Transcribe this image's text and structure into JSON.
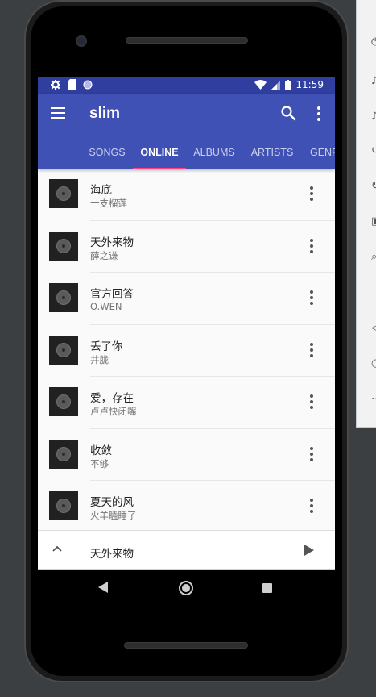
{
  "status_bar": {
    "time": "11:59",
    "icons_left": [
      "settings-icon",
      "sd-card-icon",
      "sync-circle-icon"
    ],
    "icons_right": [
      "wifi-icon",
      "signal-icon",
      "battery-icon"
    ]
  },
  "app_bar": {
    "title": "slim",
    "color": "#3f51b5",
    "status_color": "#303f9f",
    "indicator_color": "#ff4081"
  },
  "tabs": [
    {
      "label": "SONGS",
      "active": false
    },
    {
      "label": "ONLINE",
      "active": true
    },
    {
      "label": "ALBUMS",
      "active": false
    },
    {
      "label": "ARTISTS",
      "active": false
    },
    {
      "label": "GENR",
      "active": false
    }
  ],
  "songs": [
    {
      "title": "海底",
      "artist": "一支榴莲"
    },
    {
      "title": "天外来物",
      "artist": "薛之谦"
    },
    {
      "title": "官方回答",
      "artist": "O.WEN"
    },
    {
      "title": "丢了你",
      "artist": "井胧"
    },
    {
      "title": "爱，存在",
      "artist": "卢卢快闭嘴"
    },
    {
      "title": "收敛",
      "artist": "不够"
    },
    {
      "title": "夏天的风",
      "artist": "火羊瞌睡了"
    }
  ],
  "now_playing": {
    "title": "天外来物"
  }
}
